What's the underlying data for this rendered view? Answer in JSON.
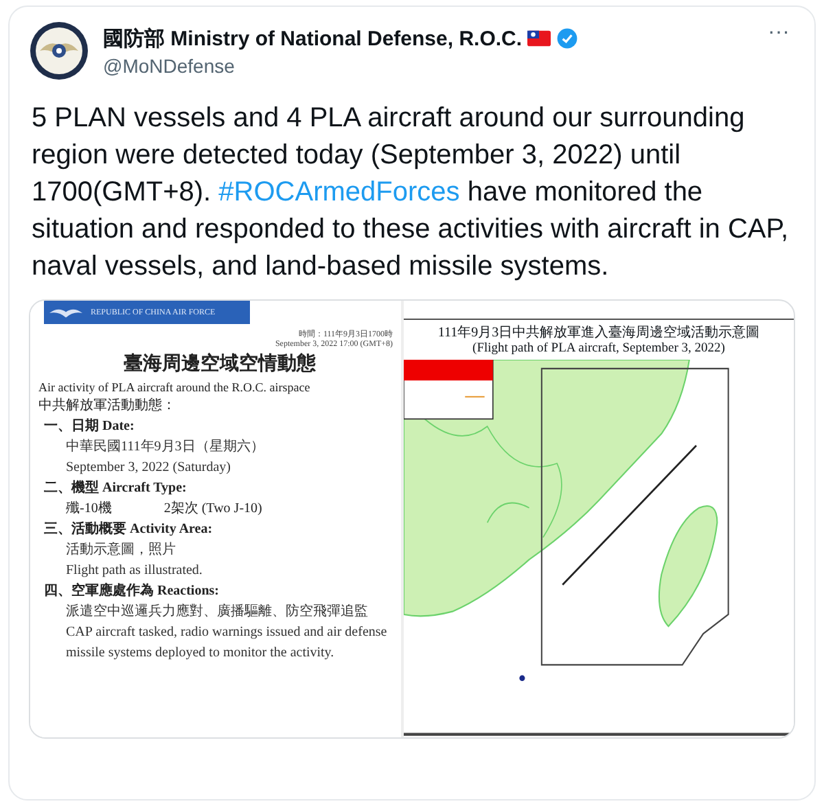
{
  "tweet": {
    "author": "國防部 Ministry of National Defense, R.O.C.",
    "handle": "@MoNDefense",
    "more": "···",
    "text_parts": [
      {
        "kind": "text",
        "text": "5 PLAN vessels and 4 PLA aircraft around our surrounding region were detected today (September 3, 2022) until 1700(GMT+8). "
      },
      {
        "kind": "hashtag",
        "text": "#ROCArmedForces"
      },
      {
        "kind": "text",
        "text": " have monitored the situation and responded to these activities with aircraft in CAP, naval vessels, and land-based missile systems."
      }
    ]
  },
  "document": {
    "banner": "REPUBLIC OF CHINA AIR FORCE",
    "time_zh": "時間：111年9月3日1700時",
    "time_en": "September 3, 2022 17:00 (GMT+8)",
    "title": "臺海周邊空域空情動態",
    "subtitle": "Air activity of PLA aircraft around the R.O.C. airspace",
    "intro": "中共解放軍活動動態：",
    "lines": [
      {
        "kind": "heading",
        "text": "一、日期 Date:"
      },
      {
        "kind": "body",
        "text": "中華民國111年9月3日（星期六）"
      },
      {
        "kind": "body",
        "text": "September 3, 2022 (Saturday)"
      },
      {
        "kind": "heading",
        "text": "二、機型 Aircraft Type:"
      },
      {
        "kind": "pair",
        "text": "殲-10機",
        "note": "2架次 (Two J-10)"
      },
      {
        "kind": "heading",
        "text": "三、活動概要 Activity Area:"
      },
      {
        "kind": "body",
        "text": "活動示意圖，照片"
      },
      {
        "kind": "body",
        "text": "Flight path as illustrated."
      },
      {
        "kind": "heading",
        "text": "四、空軍應處作為 Reactions:"
      },
      {
        "kind": "body",
        "text": "派遣空中巡邏兵力應對、廣播驅離、防空飛彈追監"
      },
      {
        "kind": "body",
        "text": "CAP aircraft tasked, radio warnings issued and air defense missile systems deployed to monitor the activity."
      }
    ]
  },
  "map": {
    "title_zh": "111年9月3日中共解放軍進入臺海周邊空域活動示意圖",
    "title_en": "(Flight path of PLA aircraft, September 3, 2022)",
    "kind": "picture"
  }
}
